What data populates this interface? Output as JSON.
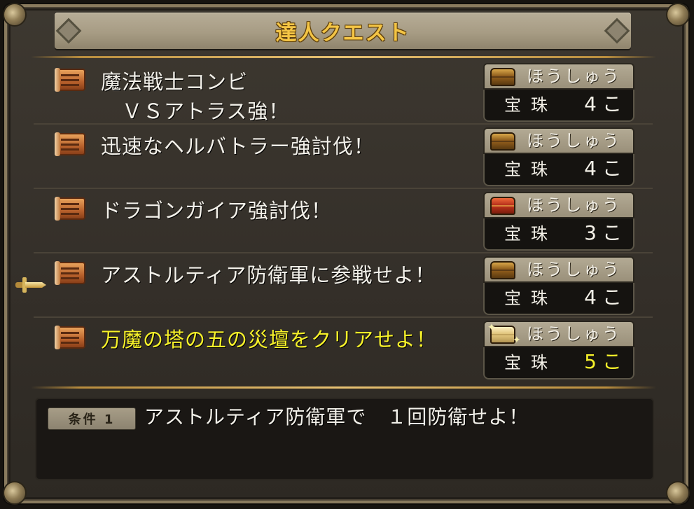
{
  "window": {
    "title": "達人クエスト"
  },
  "quests": [
    {
      "name_line1": "魔法戦士コンビ",
      "name_line2": "ＶＳアトラス強！",
      "reward_label": "ほうしゅう",
      "reward_item": "宝珠",
      "reward_count": "4",
      "reward_unit": "こ",
      "chest": "gold-chest-icon",
      "highlight": false
    },
    {
      "name_line1": "迅速なヘルバトラー強討伐！",
      "name_line2": "",
      "reward_label": "ほうしゅう",
      "reward_item": "宝珠",
      "reward_count": "4",
      "reward_unit": "こ",
      "chest": "gold-chest-icon",
      "highlight": false
    },
    {
      "name_line1": "ドラゴンガイア強討伐！",
      "name_line2": "",
      "reward_label": "ほうしゅう",
      "reward_item": "宝珠",
      "reward_count": "3",
      "reward_unit": "こ",
      "chest": "red-chest-icon",
      "highlight": false
    },
    {
      "name_line1": "アストルティア防衛軍に参戦せよ！",
      "name_line2": "",
      "reward_label": "ほうしゅう",
      "reward_item": "宝珠",
      "reward_count": "4",
      "reward_unit": "こ",
      "chest": "gold-chest-icon",
      "highlight": false
    },
    {
      "name_line1": "万魔の塔の五の災壇をクリアせよ！",
      "name_line2": "",
      "reward_label": "ほうしゅう",
      "reward_item": "宝珠",
      "reward_count": "5",
      "reward_unit": "こ",
      "chest": "sparkle-chest-icon",
      "highlight": true
    }
  ],
  "condition": {
    "badge": "条件 1",
    "text": "アストルティア防衛軍で　１回防衛せよ！"
  },
  "colors": {
    "highlight": "#f7f22a",
    "title": "#f4c545",
    "text": "#f3f1ea"
  }
}
